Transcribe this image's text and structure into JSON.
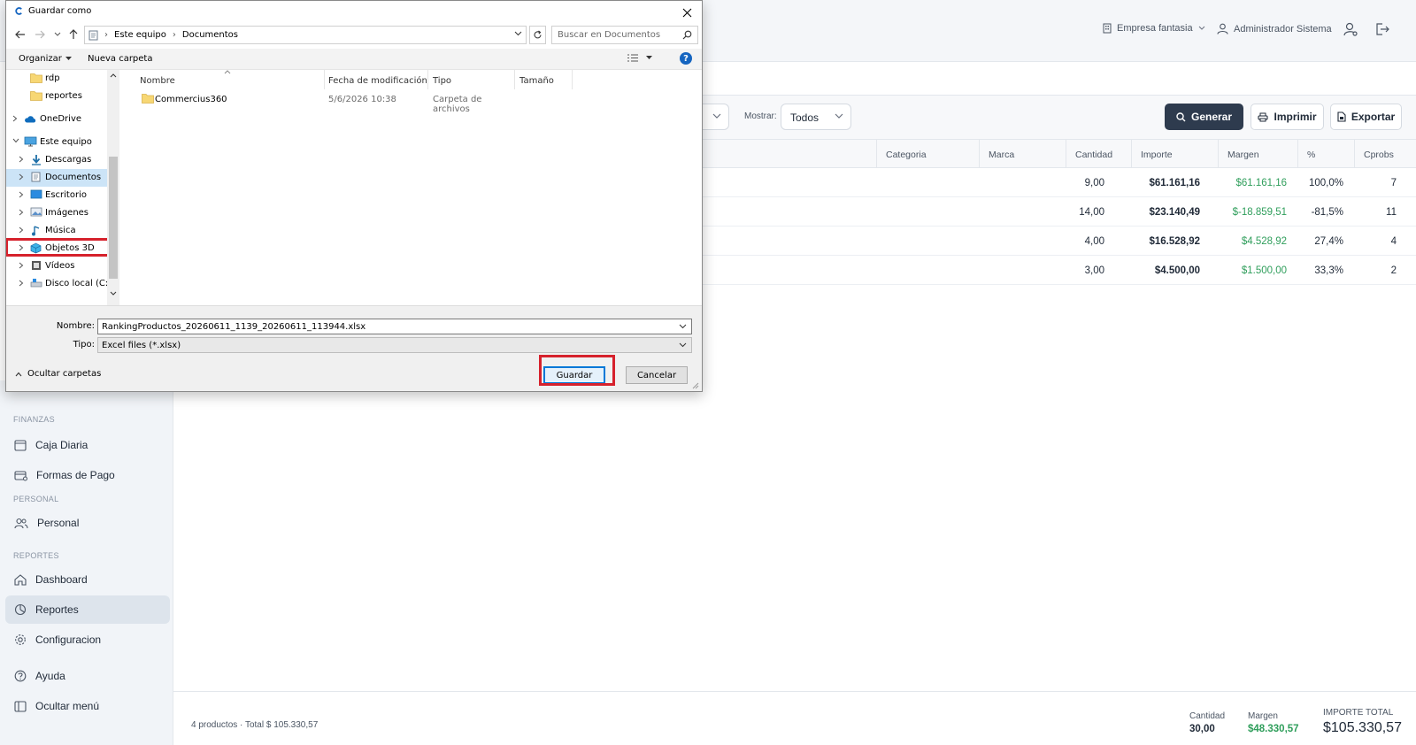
{
  "app": {
    "topbar": {
      "company": "Empresa fantasia",
      "user": "Administrador Sistema"
    },
    "filters": {
      "mostrar_label": "Mostrar:",
      "mostrar_value": "Todos",
      "generar": "Generar",
      "imprimir": "Imprimir",
      "exportar": "Exportar"
    },
    "table": {
      "headers": [
        "Categoria",
        "Marca",
        "Cantidad",
        "Importe",
        "Margen",
        "%",
        "Cprobs"
      ],
      "rows": [
        {
          "cantidad": "9,00",
          "importe": "$61.161,16",
          "margen": "$61.161,16",
          "pct": "100,0%",
          "cprobs": "7"
        },
        {
          "cantidad": "14,00",
          "importe": "$23.140,49",
          "margen": "$-18.859,51",
          "pct": "-81,5%",
          "cprobs": "11"
        },
        {
          "cantidad": "4,00",
          "importe": "$16.528,92",
          "margen": "$4.528,92",
          "pct": "27,4%",
          "cprobs": "4"
        },
        {
          "cantidad": "3,00",
          "importe": "$4.500,00",
          "margen": "$1.500,00",
          "pct": "33,3%",
          "cprobs": "2"
        }
      ]
    },
    "footer": {
      "summary": "4 productos · Total $ 105.330,57",
      "cantidad_label": "Cantidad",
      "cantidad_value": "30,00",
      "margen_label": "Margen",
      "margen_value": "$48.330,57",
      "total_label": "IMPORTE TOTAL",
      "total_value": "$105.330,57"
    },
    "sidebar": {
      "finanzas": "FINANZAS",
      "caja": "Caja Diaria",
      "formas": "Formas de Pago",
      "personal_section": "PERSONAL",
      "personal": "Personal",
      "reportes_section": "REPORTES",
      "dashboard": "Dashboard",
      "reportes": "Reportes",
      "configuracion": "Configuracion",
      "ayuda": "Ayuda",
      "ocultar": "Ocultar menú"
    }
  },
  "dialog": {
    "title": "Guardar como",
    "breadcrumb": [
      "Este equipo",
      "Documentos"
    ],
    "search_placeholder": "Buscar en Documentos",
    "organizar": "Organizar",
    "nueva_carpeta": "Nueva carpeta",
    "tree": [
      "rdp",
      "reportes",
      "OneDrive",
      "Este equipo",
      "Descargas",
      "Documentos",
      "Escritorio",
      "Imágenes",
      "Música",
      "Objetos 3D",
      "Vídeos",
      "Disco local (C:)"
    ],
    "columns": [
      "Nombre",
      "Fecha de modificación",
      "Tipo",
      "Tamaño"
    ],
    "files": [
      {
        "name": "Commercius360",
        "date": "5/6/2026 10:38",
        "type": "Carpeta de archivos",
        "size": ""
      }
    ],
    "nombre_label": "Nombre:",
    "nombre_value": "RankingProductos_20260611_1139_20260611_113944.xlsx",
    "tipo_label": "Tipo:",
    "tipo_value": "Excel files (*.xlsx)",
    "ocultar_carpetas": "Ocultar carpetas",
    "guardar": "Guardar",
    "cancelar": "Cancelar"
  },
  "colors": {
    "accent_dark": "#2e3b4e",
    "positive_green": "#2f9e5b",
    "highlight_red": "#d6212c",
    "windows_blue": "#0078d7"
  }
}
